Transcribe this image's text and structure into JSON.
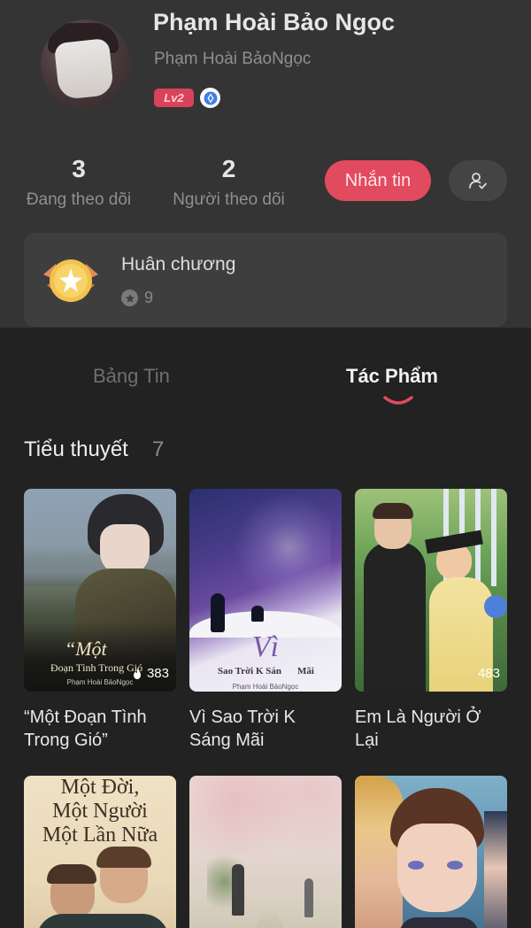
{
  "profile": {
    "display_name": "Phạm Hoài Bảo Ngọc",
    "handle": "Phạm Hoài BảoNgọc",
    "level": "Lv2"
  },
  "stats": {
    "following_count": "3",
    "following_label": "Đang theo dõi",
    "followers_count": "2",
    "followers_label": "Người theo dõi"
  },
  "actions": {
    "message_label": "Nhắn tin"
  },
  "medals": {
    "title": "Huân chương",
    "count": "9"
  },
  "tabs": [
    {
      "label": "Bảng Tin",
      "active": false
    },
    {
      "label": "Tác Phẩm",
      "active": true
    }
  ],
  "section": {
    "title": "Tiểu thuyết",
    "count": "7"
  },
  "books": [
    {
      "title": "“Một Đoạn Tình Trong Gió”",
      "cover_script": "“Một",
      "cover_subtitle": "Đoạn Tình Trong Gió",
      "cover_author": "Phạm Hoài BảoNgọc",
      "read_count": "383"
    },
    {
      "title": "Vì Sao Trời K Sáng Mãi",
      "cover_script": "Vì",
      "cover_subtitle": "Sao Trời K Sán",
      "cover_subtitle_2": "Mãi",
      "cover_author": "Phạm Hoài BảoNgọc",
      "read_count": ""
    },
    {
      "title": "Em Là Người Ở Lại",
      "read_count": "483"
    },
    {
      "cover_lines": [
        "Một Đời,",
        "Một Người",
        "Một Lần Nữa"
      ]
    },
    {},
    {}
  ],
  "colors": {
    "background": "#222222",
    "header_background": "#343434",
    "accent": "#e24a5f"
  }
}
